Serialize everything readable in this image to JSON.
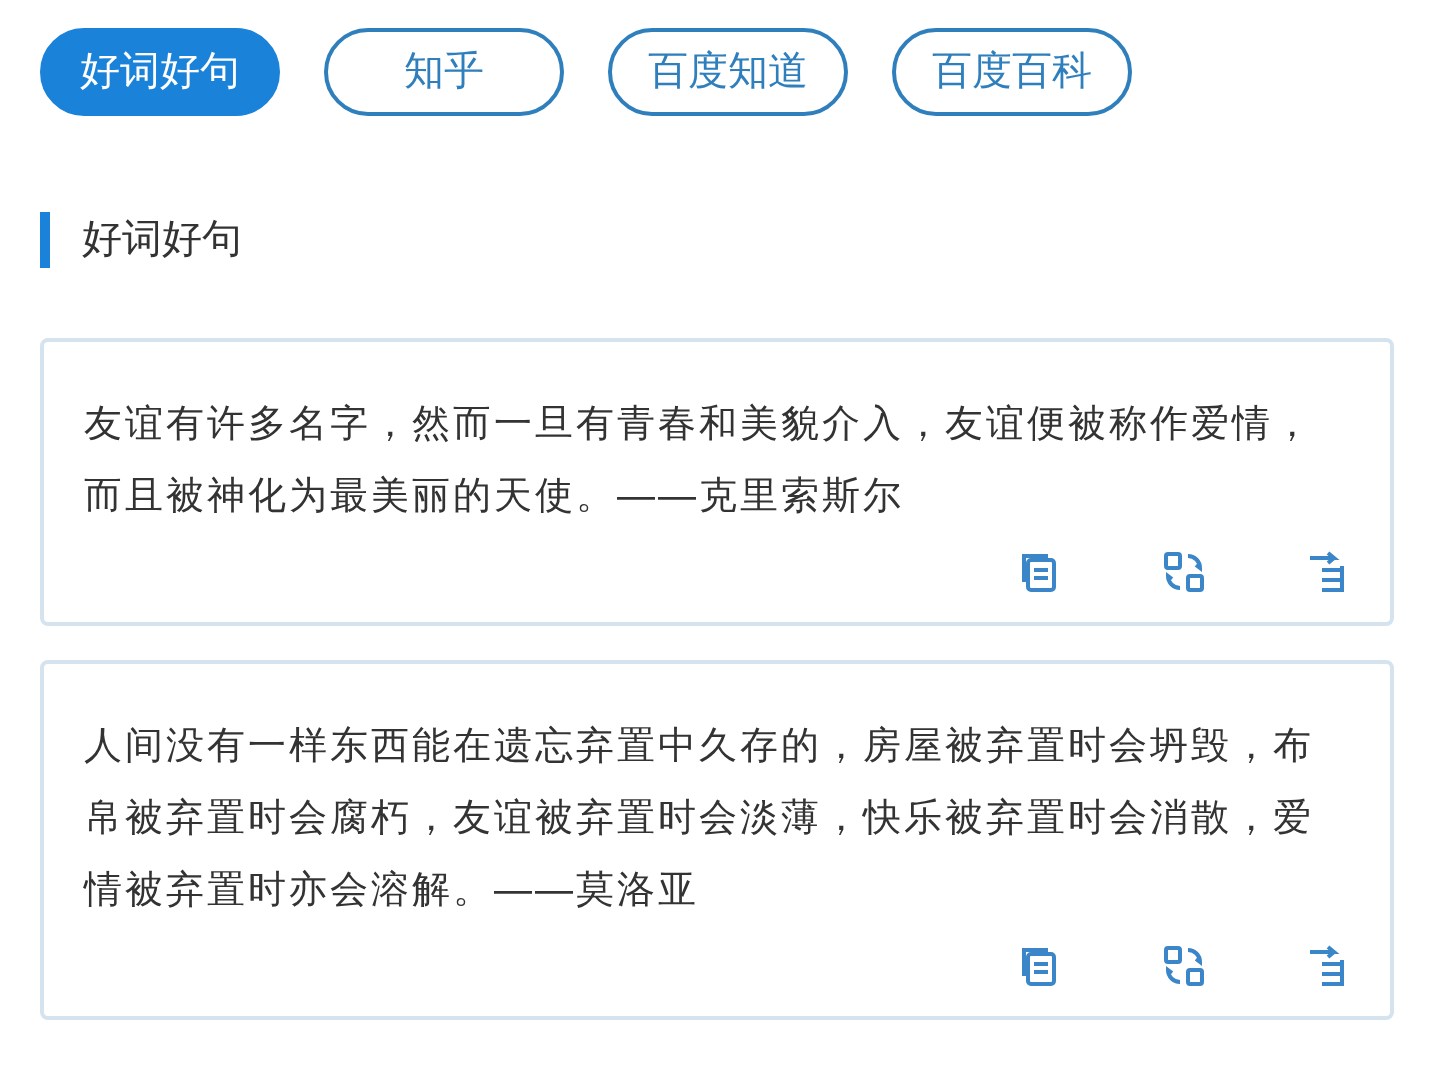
{
  "tabs": [
    {
      "label": "好词好句",
      "selected": true
    },
    {
      "label": "知乎",
      "selected": false
    },
    {
      "label": "百度知道",
      "selected": false
    },
    {
      "label": "百度百科",
      "selected": false
    }
  ],
  "section": {
    "title": "好词好句"
  },
  "cards": [
    {
      "text": "友谊有许多名字，然而一旦有青春和美貌介入，友谊便被称作爱情，而且被神化为最美丽的天使。——克里索斯尔"
    },
    {
      "text": "人间没有一样东西能在遗忘弃置中久存的，房屋被弃置时会坍毁，布帛被弃置时会腐朽，友谊被弃置时会淡薄，快乐被弃置时会消散，爱情被弃置时亦会溶解。——莫洛亚"
    }
  ]
}
